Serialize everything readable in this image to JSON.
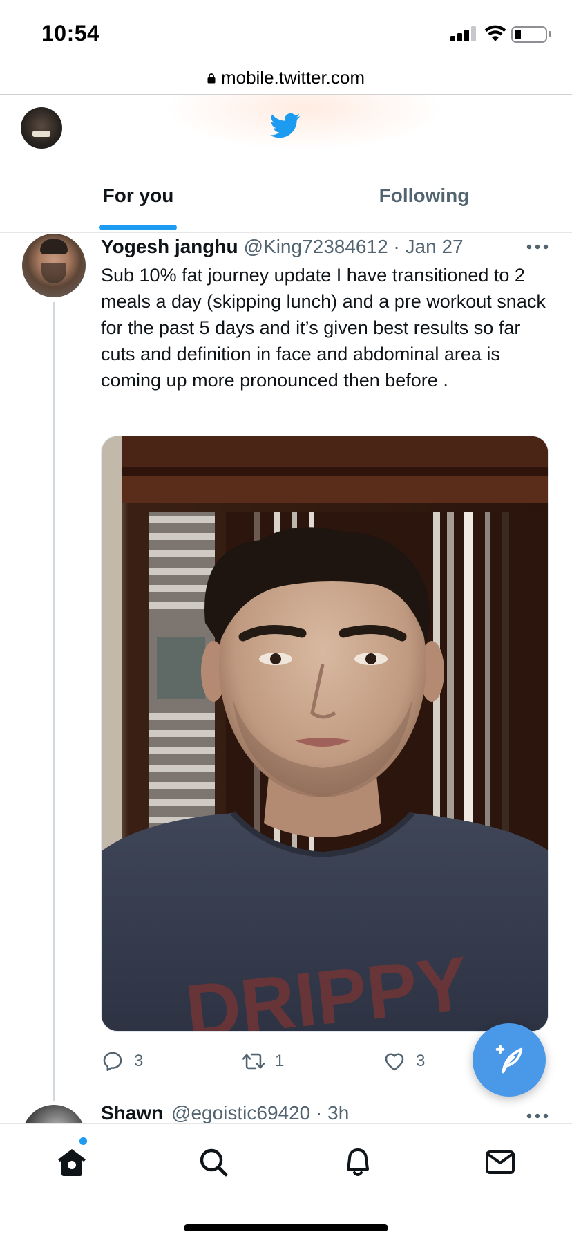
{
  "status_bar": {
    "time": "10:54",
    "battery_level": 0.2,
    "icons": [
      "signal-icon",
      "wifi-icon",
      "battery-icon"
    ]
  },
  "browser": {
    "url": "mobile.twitter.com",
    "icons": [
      "lock-icon"
    ]
  },
  "header": {
    "icons": [
      "profile-avatar",
      "twitter-bird-icon"
    ],
    "brand_color": "#1d9bf0",
    "tabs": [
      {
        "label": "For you",
        "selected": true
      },
      {
        "label": "Following",
        "selected": false
      }
    ]
  },
  "tweet": {
    "author_name": "Yogesh janghu",
    "author_handle_date": "@King72384612 · Jan 27",
    "text": "Sub 10% fat journey update I have transitioned to 2 meals a day (skipping lunch) and a pre workout snack for the past 5 days and it’s given best results so far cuts and definition in face and abdominal area is coming up more pronounced then before .",
    "media": "selfie-photo",
    "replies": "3",
    "retweets": "1",
    "likes": "3",
    "icons": [
      "reply-icon",
      "retweet-icon",
      "like-icon",
      "more-icon"
    ]
  },
  "next_tweet": {
    "author_name": "Shawn",
    "author_handle_date": "@egoistic69420 · 3h"
  },
  "compose": {
    "icon": "compose-tweet-icon",
    "color": "#4a99e9"
  },
  "bottom_nav": {
    "items": [
      "home-icon",
      "search-icon",
      "notifications-icon",
      "messages-icon"
    ],
    "home_has_notification_dot": true
  }
}
